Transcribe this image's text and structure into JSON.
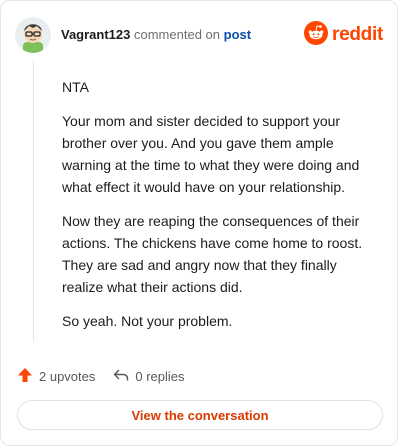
{
  "header": {
    "username": "Vagrant123",
    "action_text": "commented on",
    "post_link": "post",
    "brand": "reddit"
  },
  "comment": {
    "paragraphs": [
      "NTA",
      "Your mom and sister decided to support your brother over you. And you gave them ample warning at the time to what they were doing and what effect it would have on your relationship.",
      "Now they are reaping the consequences of their actions. The chickens have come home to roost. They are sad and angry now that they finally realize what their actions did.",
      "So yeah. Not your problem."
    ]
  },
  "stats": {
    "upvotes": "2 upvotes",
    "replies": "0 replies"
  },
  "cta": {
    "label": "View the conversation"
  },
  "colors": {
    "accent": "#ff4500",
    "cta_text": "#d93a00",
    "link": "#0a4fa8"
  },
  "icons": [
    "avatar",
    "reddit-logo-icon",
    "upvote-arrow-icon",
    "reply-arrow-icon"
  ]
}
